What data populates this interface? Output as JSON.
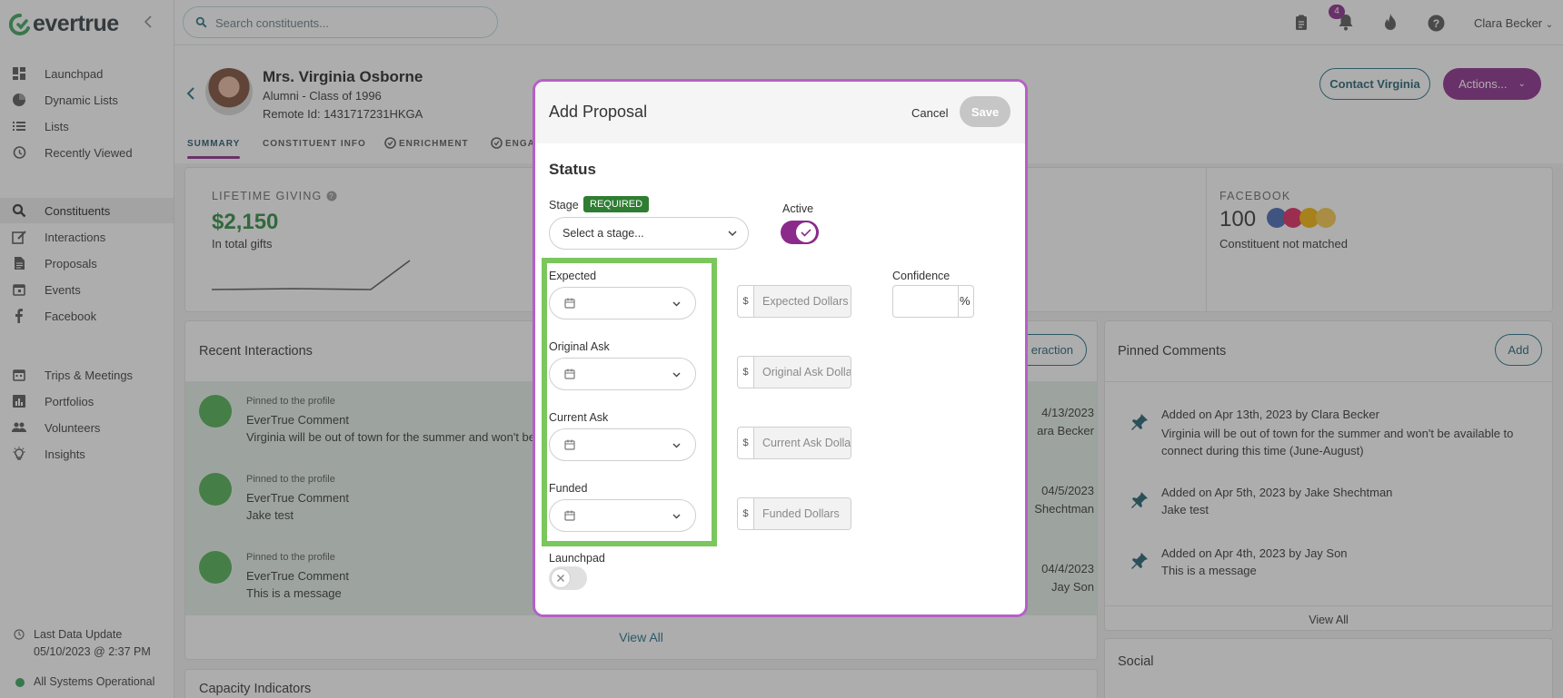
{
  "app": {
    "logo_text": "evertrue"
  },
  "search": {
    "placeholder": "Search constituents..."
  },
  "topbar": {
    "notification_count": "4",
    "user_name": "Clara Becker"
  },
  "sidebar": {
    "items": [
      {
        "label": "Launchpad",
        "icon": "dashboard-icon"
      },
      {
        "label": "Dynamic Lists",
        "icon": "pie-chart-icon"
      },
      {
        "label": "Lists",
        "icon": "list-icon"
      },
      {
        "label": "Recently Viewed",
        "icon": "history-icon"
      },
      {
        "label": "Constituents",
        "icon": "search-icon"
      },
      {
        "label": "Interactions",
        "icon": "edit-icon"
      },
      {
        "label": "Proposals",
        "icon": "document-icon"
      },
      {
        "label": "Events",
        "icon": "calendar-icon"
      },
      {
        "label": "Facebook",
        "icon": "facebook-icon"
      },
      {
        "label": "Trips & Meetings",
        "icon": "calendar-icon"
      },
      {
        "label": "Portfolios",
        "icon": "bar-chart-icon"
      },
      {
        "label": "Volunteers",
        "icon": "people-icon"
      },
      {
        "label": "Insights",
        "icon": "lightbulb-icon"
      }
    ],
    "footer": {
      "last_update_label": "Last Data Update",
      "last_update_value": "05/10/2023 @ 2:37 PM",
      "status": "All Systems Operational"
    }
  },
  "profile": {
    "name": "Mrs. Virginia Osborne",
    "subtitle": "Alumni - Class of 1996",
    "remote_id": "Remote Id: 1431717231HKGA",
    "tabs": [
      "SUMMARY",
      "CONSTITUENT INFO",
      "ENRICHMENT",
      "ENGA"
    ],
    "contact_button": "Contact Virginia",
    "actions_button": "Actions..."
  },
  "giving": {
    "label": "LIFETIME GIVING",
    "amount": "$2,150",
    "caption": "In total gifts"
  },
  "facebook_card": {
    "label": "FACEBOOK",
    "count": "100",
    "caption": "Constituent not matched"
  },
  "recent_interactions": {
    "title": "Recent Interactions",
    "add_button_partial": "eraction",
    "items": [
      {
        "pinned": "Pinned to the profile",
        "type": "EverTrue Comment",
        "text": "Virginia will be out of town for the summer and won't be",
        "date": "4/13/2023",
        "author": "ara Becker"
      },
      {
        "pinned": "Pinned to the profile",
        "type": "EverTrue Comment",
        "text": "Jake test",
        "date": "04/5/2023",
        "author": "Shechtman"
      },
      {
        "pinned": "Pinned to the profile",
        "type": "EverTrue Comment",
        "text": "This is a message",
        "date": "04/4/2023",
        "author": "Jay Son"
      }
    ],
    "view_all": "View All"
  },
  "capacity": {
    "title": "Capacity Indicators"
  },
  "pinned_comments": {
    "title": "Pinned Comments",
    "add_button": "Add",
    "items": [
      {
        "meta": "Added on Apr 13th, 2023 by Clara Becker",
        "text": "Virginia will be out of town for the summer and won't be available to connect during this time (June-August)"
      },
      {
        "meta": "Added on Apr 5th, 2023 by Jake Shechtman",
        "text": "Jake test"
      },
      {
        "meta": "Added on Apr 4th, 2023 by Jay Son",
        "text": "This is a message"
      }
    ],
    "view_all": "View All"
  },
  "social": {
    "title": "Social"
  },
  "modal": {
    "title": "Add Proposal",
    "cancel": "Cancel",
    "save": "Save",
    "status_heading": "Status",
    "stage_label": "Stage",
    "required_badge": "REQUIRED",
    "stage_placeholder": "Select a stage...",
    "active_label": "Active",
    "active": true,
    "confidence_label": "Confidence",
    "percent_symbol": "%",
    "currency_symbol": "$",
    "fields": [
      {
        "label": "Expected",
        "money_placeholder": "Expected Dollars"
      },
      {
        "label": "Original Ask",
        "money_placeholder": "Original Ask Dollars"
      },
      {
        "label": "Current Ask",
        "money_placeholder": "Current Ask Dollars"
      },
      {
        "label": "Funded",
        "money_placeholder": "Funded Dollars"
      }
    ],
    "launchpad_label": "Launchpad",
    "launchpad": false
  },
  "colors": {
    "brand_purple": "#8b2a8b",
    "teal": "#1f6f83",
    "success_green": "#2e7d32",
    "highlight_green": "#7ac75d"
  }
}
